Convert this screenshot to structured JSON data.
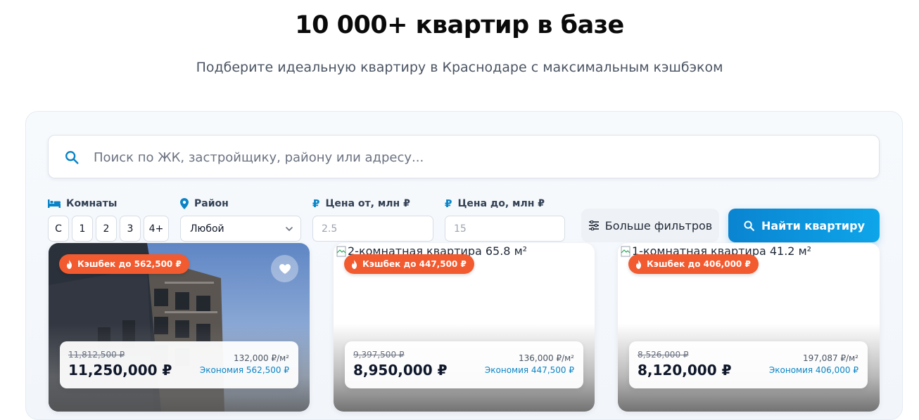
{
  "hero": {
    "title": "10 000+ квартир в базе",
    "subtitle": "Подберите идеальную квартиру в Краснодаре с максимальным кэшбэком"
  },
  "search": {
    "placeholder": "Поиск по ЖК, застройщику, району или адресу...",
    "icon": "search-icon"
  },
  "filters": {
    "rooms": {
      "label": "Комнаты",
      "icon": "bed-icon",
      "options": [
        "С",
        "1",
        "2",
        "3",
        "4+"
      ]
    },
    "district": {
      "label": "Район",
      "icon": "map-pin-icon",
      "value": "Любой"
    },
    "price_from": {
      "label": "Цена от, млн ₽",
      "icon": "ruble-icon",
      "placeholder": "2.5"
    },
    "price_to": {
      "label": "Цена до, млн ₽",
      "icon": "ruble-icon",
      "placeholder": "15"
    },
    "more_label": "Больше фильтров",
    "find_label": "Найти квартиру"
  },
  "colors": {
    "accent": "#0a84c6",
    "cashback": "#f25a2f"
  },
  "cards": [
    {
      "alt": "",
      "cashback": "Кэшбек до 562,500 ₽",
      "old_price": "11,812,500 ₽",
      "price": "11,250,000 ₽",
      "per_m2": "132,000 ₽/м²",
      "saving": "Экономия 562,500 ₽"
    },
    {
      "alt": "2-комнатная квартира 65.8 м²",
      "cashback": "Кэшбек до 447,500 ₽",
      "old_price": "9,397,500 ₽",
      "price": "8,950,000 ₽",
      "per_m2": "136,000 ₽/м²",
      "saving": "Экономия 447,500 ₽"
    },
    {
      "alt": "1-комнатная квартира 41.2 м²",
      "cashback": "Кэшбек до 406,000 ₽",
      "old_price": "8,526,000 ₽",
      "price": "8,120,000 ₽",
      "per_m2": "197,087 ₽/м²",
      "saving": "Экономия 406,000 ₽"
    }
  ]
}
